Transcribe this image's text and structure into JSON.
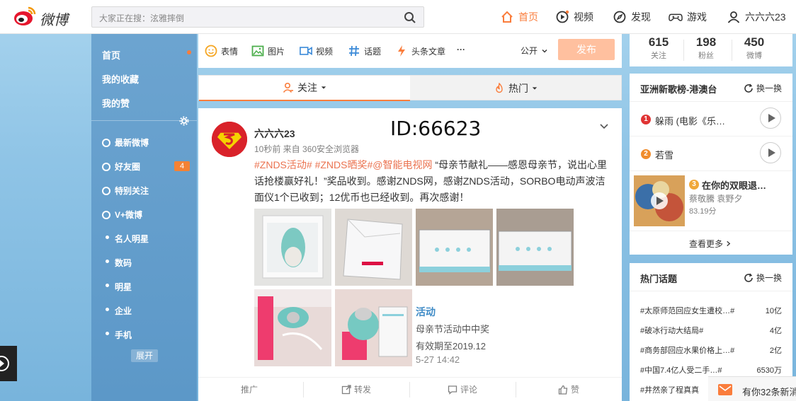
{
  "header": {
    "logo_text": "微博",
    "search_placeholder": "大家正在搜：泫雅摔倒",
    "nav": [
      {
        "label": "首页",
        "icon": "home-icon",
        "active": true
      },
      {
        "label": "视频",
        "icon": "video-icon"
      },
      {
        "label": "发现",
        "icon": "compass-icon"
      },
      {
        "label": "游戏",
        "icon": "gamepad-icon"
      },
      {
        "label": "六六六23",
        "icon": "user-icon"
      }
    ]
  },
  "sidebar": {
    "top_items": [
      "首页",
      "我的收藏",
      "我的赞"
    ],
    "groups": [
      {
        "label": "最新微博",
        "icon": "clock-icon"
      },
      {
        "label": "好友圈",
        "icon": "heart-icon",
        "badge": "4"
      },
      {
        "label": "特别关注",
        "icon": "eye-icon"
      },
      {
        "label": "V+微博",
        "icon": "vplus-icon"
      }
    ],
    "sub_items": [
      "名人明星",
      "数码",
      "明星",
      "企业",
      "手机"
    ],
    "expand_label": "展开"
  },
  "composer": {
    "tools": [
      {
        "label": "表情",
        "icon": "smile-icon"
      },
      {
        "label": "图片",
        "icon": "image-icon"
      },
      {
        "label": "视频",
        "icon": "video-camera-icon"
      },
      {
        "label": "话题",
        "icon": "hashtag-icon"
      },
      {
        "label": "头条文章",
        "icon": "lightning-icon"
      }
    ],
    "more": "···",
    "visibility": "公开",
    "publish_label": "发布"
  },
  "feed_tabs": [
    {
      "label": "关注",
      "icon": "follow-icon",
      "active": true
    },
    {
      "label": "热门",
      "icon": "fire-icon",
      "active": false
    }
  ],
  "post": {
    "author": "六六六23",
    "meta": "10秒前 来自 360安全浏览器",
    "watermark": "ID:66623",
    "tags": "#ZNDS活动# #ZNDS晒奖#@智能电视网",
    "body": "“母亲节献礼——感恩母亲节，说出心里话抢楼赢好礼！”奖品收到。感谢ZNDS网，感谢ZNDS活动，SORBO电动声波洁面仪1个已收到；12优币也已经收到。再次感谢！",
    "image_card_text": [
      "活动",
      "母亲节活动中中奖",
      "有效期至2019.12",
      "5-27 14:42"
    ],
    "actions": [
      "推广",
      "转发",
      "评论",
      "赞"
    ]
  },
  "profile_stats": [
    {
      "value": "615",
      "label": "关注"
    },
    {
      "value": "198",
      "label": "粉丝"
    },
    {
      "value": "450",
      "label": "微博"
    }
  ],
  "music_card": {
    "title": "亚洲新歌榜-港澳台",
    "refresh_label": "换一换",
    "songs": [
      {
        "rank": "1",
        "title": "躲雨 (电影《乐…"
      },
      {
        "rank": "2",
        "title": "若雪"
      },
      {
        "rank": "3",
        "title": "在你的双眼退…",
        "artist": "蔡敬騰 袁野夕",
        "plays": "83.19分"
      }
    ],
    "more_label": "查看更多"
  },
  "topics_card": {
    "title": "热门话题",
    "refresh_label": "换一换",
    "topics": [
      {
        "title": "#太原师范回应女生遭校…#",
        "count": "10亿"
      },
      {
        "title": "#破冰行动大结局#",
        "count": "4亿"
      },
      {
        "title": "#商务部回应水果价格上…#",
        "count": "2亿"
      },
      {
        "title": "#中国7.4亿人受二手…#",
        "count": "6530万"
      },
      {
        "title": "#井然亲了程真真",
        "count": ""
      }
    ]
  },
  "notification": "有你32条新消"
}
